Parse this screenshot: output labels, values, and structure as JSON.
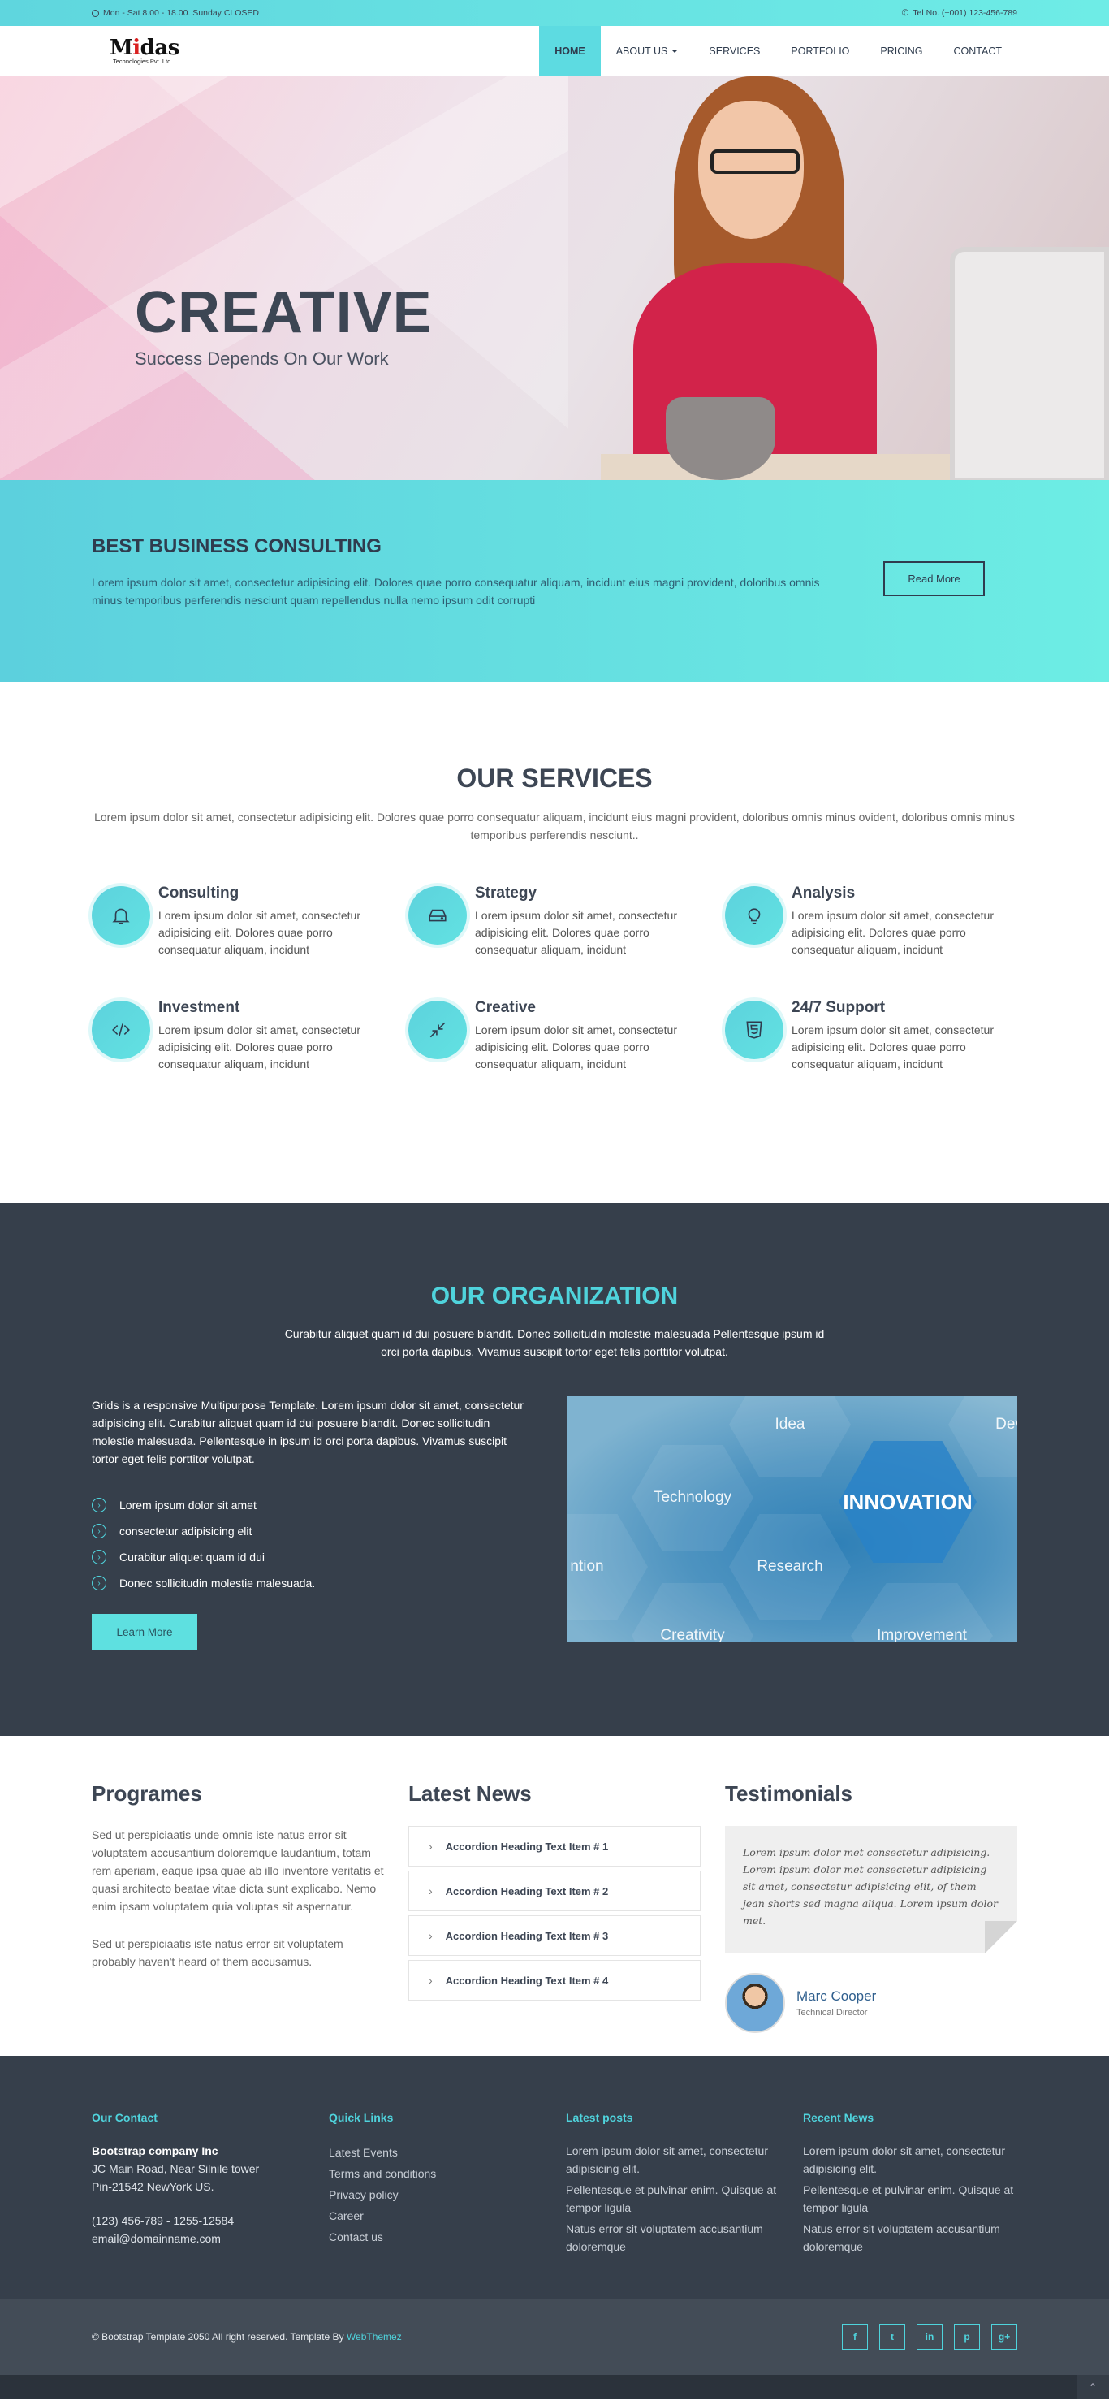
{
  "topbar": {
    "hours": "Mon - Sat 8.00 - 18.00. Sunday CLOSED",
    "phone": "Tel No. (+001) 123-456-789"
  },
  "logo": {
    "part1": "M",
    "part2": "i",
    "part3": "das",
    "sub": "Technologies Pvt. Ltd."
  },
  "nav": {
    "items": [
      "HOME",
      "ABOUT US",
      "SERVICES",
      "PORTFOLIO",
      "PRICING",
      "CONTACT"
    ]
  },
  "hero": {
    "title": "CREATIVE",
    "subtitle": "Success Depends On Our Work"
  },
  "band": {
    "title": "BEST BUSINESS CONSULTING",
    "text": "Lorem ipsum dolor sit amet, consectetur adipisicing elit. Dolores quae porro consequatur aliquam, incidunt eius magni provident, doloribus omnis minus temporibus perferendis nesciunt quam repellendus nulla nemo ipsum odit corrupti",
    "button": "Read More"
  },
  "services": {
    "title": "OUR SERVICES",
    "intro": "Lorem ipsum dolor sit amet, consectetur adipisicing elit. Dolores quae porro consequatur aliquam, incidunt eius magni provident, doloribus omnis minus ovident, doloribus omnis minus temporibus perferendis nesciunt..",
    "items": [
      {
        "title": "Consulting",
        "text": "Lorem ipsum dolor sit amet, consectetur adipisicing elit. Dolores quae porro consequatur aliquam, incidunt",
        "icon": "bell-icon"
      },
      {
        "title": "Strategy",
        "text": "Lorem ipsum dolor sit amet, consectetur adipisicing elit. Dolores quae porro consequatur aliquam, incidunt",
        "icon": "hard-drive-icon"
      },
      {
        "title": "Analysis",
        "text": "Lorem ipsum dolor sit amet, consectetur adipisicing elit. Dolores quae porro consequatur aliquam, incidunt",
        "icon": "bulb-icon"
      },
      {
        "title": "Investment",
        "text": "Lorem ipsum dolor sit amet, consectetur adipisicing elit. Dolores quae porro consequatur aliquam, incidunt",
        "icon": "code-icon"
      },
      {
        "title": "Creative",
        "text": "Lorem ipsum dolor sit amet, consectetur adipisicing elit. Dolores quae porro consequatur aliquam, incidunt",
        "icon": "compress-icon"
      },
      {
        "title": "24/7 Support",
        "text": "Lorem ipsum dolor sit amet, consectetur adipisicing elit. Dolores quae porro consequatur aliquam, incidunt",
        "icon": "html5-icon"
      }
    ]
  },
  "org": {
    "title": "OUR ORGANIZATION",
    "intro": "Curabitur aliquet quam id dui posuere blandit. Donec sollicitudin molestie malesuada Pellentesque ipsum id orci porta dapibus. Vivamus suscipit tortor eget felis porttitor volutpat.",
    "lead": "Grids is a responsive Multipurpose Template. Lorem ipsum dolor sit amet, consectetur adipisicing elit. Curabitur aliquet quam id dui posuere blandit. Donec sollicitudin molestie malesuada. Pellentesque in ipsum id orci porta dapibus. Vivamus suscipit tortor eget felis porttitor volutpat.",
    "list": [
      "Lorem ipsum dolor sit amet",
      "consectetur adipisicing elit",
      "Curabitur aliquet quam id dui",
      "Donec sollicitudin molestie malesuada."
    ],
    "button": "Learn More",
    "image_words": [
      "Idea",
      "Dev",
      "Technology",
      "INNOVATION",
      "ntion",
      "Research",
      "Creativity",
      "Improvement"
    ]
  },
  "programs": {
    "title": "Programes",
    "p1": "Sed ut perspiciaatis unde omnis iste natus error sit voluptatem accusantium doloremque laudantium, totam rem aperiam, eaque ipsa quae ab illo inventore veritatis et quasi architecto beatae vitae dicta sunt explicabo. Nemo enim ipsam voluptatem quia voluptas sit aspernatur.",
    "p2": "Sed ut perspiciaatis iste natus error sit voluptatem probably haven't heard of them accusamus."
  },
  "news": {
    "title": "Latest News",
    "items": [
      "Accordion Heading Text Item # 1",
      "Accordion Heading Text Item # 2",
      "Accordion Heading Text Item # 3",
      "Accordion Heading Text Item # 4"
    ]
  },
  "testimonials": {
    "title": "Testimonials",
    "quote": "Lorem ipsum dolor met consectetur adipisicing. Lorem ipsum dolor met consectetur adipisicing sit amet, consectetur adipisicing elit, of them jean shorts sed magna aliqua. Lorem ipsum dolor met.",
    "name": "Marc Cooper",
    "role": "Technical Director"
  },
  "footer": {
    "contact": {
      "title": "Our Contact",
      "company": "Bootstrap company Inc",
      "addr1": "JC Main Road, Near Silnile tower",
      "addr2": "Pin-21542 NewYork US.",
      "phone": "(123) 456-789 - 1255-12584",
      "email": "email@domainname.com"
    },
    "links": {
      "title": "Quick Links",
      "items": [
        "Latest Events",
        "Terms and conditions",
        "Privacy policy",
        "Career",
        "Contact us"
      ]
    },
    "posts": {
      "title": "Latest posts",
      "items": [
        "Lorem ipsum dolor sit amet, consectetur adipisicing elit.",
        "Pellentesque et pulvinar enim. Quisque at tempor ligula",
        "Natus error sit voluptatem accusantium doloremque"
      ]
    },
    "recent": {
      "title": "Recent News",
      "items": [
        "Lorem ipsum dolor sit amet, consectetur adipisicing elit.",
        "Pellentesque et pulvinar enim. Quisque at tempor ligula",
        "Natus error sit voluptatem accusantium doloremque"
      ]
    }
  },
  "copyright": {
    "text": "© Bootstrap Template 2050 All right reserved. Template By ",
    "link": "WebThemez"
  },
  "social": [
    "f",
    "t",
    "in",
    "p",
    "g+"
  ]
}
